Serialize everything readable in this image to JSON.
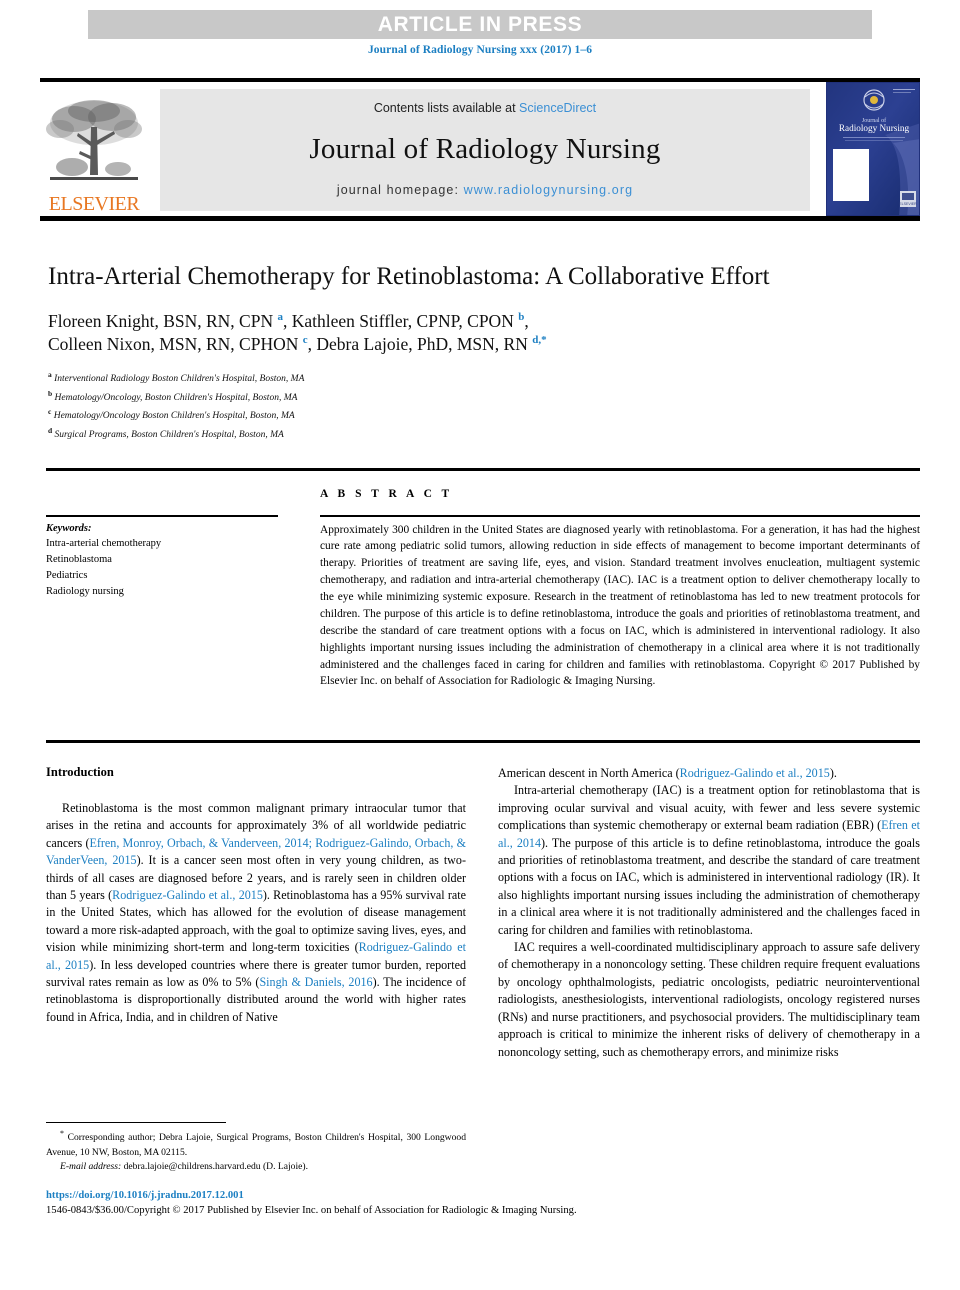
{
  "banner": {
    "article_in_press": "ARTICLE IN PRESS",
    "journal_ref": "Journal of Radiology Nursing xxx (2017) 1–6"
  },
  "masthead": {
    "contents_prefix": "Contents lists available at ",
    "sciencedirect": "ScienceDirect",
    "journal_title": "Journal of Radiology Nursing",
    "homepage_prefix": "journal homepage: ",
    "homepage_url": "www.radiologynursing.org",
    "publisher_logo_text": "ELSEVIER",
    "cover_title_line1": "Journal of",
    "cover_title_line2": "Radiology Nursing"
  },
  "article": {
    "title": "Intra-Arterial Chemotherapy for Retinoblastoma: A Collaborative Effort",
    "authors_line1_a": "Floreen Knight, BSN, RN, CPN ",
    "authors_sup_a": "a",
    "authors_line1_b": ", Kathleen Stiffler, CPNP, CPON ",
    "authors_sup_b": "b",
    "authors_line1_c": ",",
    "authors_line2_a": "Colleen Nixon, MSN, RN, CPHON ",
    "authors_sup_c": "c",
    "authors_line2_b": ", Debra Lajoie, PhD, MSN, RN ",
    "authors_sup_d": "d,*",
    "affiliations": [
      {
        "marker": "a",
        "text": "Interventional Radiology Boston Children's Hospital, Boston, MA"
      },
      {
        "marker": "b",
        "text": "Hematology/Oncology, Boston Children's Hospital, Boston, MA"
      },
      {
        "marker": "c",
        "text": "Hematology/Oncology Boston Children's Hospital, Boston, MA"
      },
      {
        "marker": "d",
        "text": "Surgical Programs, Boston Children's Hospital, Boston, MA"
      }
    ]
  },
  "keywords": {
    "label": "Keywords:",
    "items": [
      "Intra-arterial chemotherapy",
      "Retinoblastoma",
      "Pediatrics",
      "Radiology nursing"
    ]
  },
  "abstract": {
    "label": "A B S T R A C T",
    "text": "Approximately 300 children in the United States are diagnosed yearly with retinoblastoma. For a generation, it has had the highest cure rate among pediatric solid tumors, allowing reduction in side effects of management to become important determinants of therapy. Priorities of treatment are saving life, eyes, and vision. Standard treatment involves enucleation, multiagent systemic chemotherapy, and radiation and intra-arterial chemotherapy (IAC). IAC is a treatment option to deliver chemotherapy locally to the eye while minimizing systemic exposure. Research in the treatment of retinoblastoma has led to new treatment protocols for children. The purpose of this article is to define retinoblastoma, introduce the goals and priorities of retinoblastoma treatment, and describe the standard of care treatment options with a focus on IAC, which is administered in interventional radiology. It also highlights important nursing issues including the administration of chemotherapy in a clinical area where it is not traditionally administered and the challenges faced in caring for children and families with retinoblastoma. Copyright © 2017 Published by Elsevier Inc. on behalf of Association for Radiologic & Imaging Nursing."
  },
  "body": {
    "section_heading": "Introduction",
    "left_col": {
      "p1_part1": "Retinoblastoma is the most common malignant primary intraocular tumor that arises in the retina and accounts for approximately 3% of all worldwide pediatric cancers (",
      "p1_cite1": "Efren, Monroy, Orbach, & Vanderveen, 2014; Rodriguez-Galindo, Orbach, & VanderVeen, 2015",
      "p1_part2": "). It is a cancer seen most often in very young children, as two-thirds of all cases are diagnosed before 2 years, and is rarely seen in children older than 5 years (",
      "p1_cite2": "Rodriguez-Galindo et al., 2015",
      "p1_part3": "). Retinoblastoma has a 95% survival rate in the United States, which has allowed for the evolution of disease management toward a more risk-adapted approach, with the goal to optimize saving lives, eyes, and vision while minimizing short-term and long-term toxicities (",
      "p1_cite3": "Rodriguez-Galindo et al., 2015",
      "p1_part4": "). In less developed countries where there is greater tumor burden, reported survival rates remain as low as 0% to 5% (",
      "p1_cite4": "Singh & Daniels, 2016",
      "p1_part5": "). The incidence of retinoblastoma is disproportionally distributed around the world with higher rates found in Africa, India, and in children of Native"
    },
    "right_col": {
      "p0_part1": "American descent in North America (",
      "p0_cite1": "Rodriguez-Galindo et al., 2015",
      "p0_part2": ").",
      "p1_part1": "Intra-arterial chemotherapy (IAC) is a treatment option for retinoblastoma that is improving ocular survival and visual acuity, with fewer and less severe systemic complications than systemic chemotherapy or external beam radiation (EBR) (",
      "p1_cite1": "Efren et al., 2014",
      "p1_part2": "). The purpose of this article is to define retinoblastoma, introduce the goals and priorities of retinoblastoma treatment, and describe the standard of care treatment options with a focus on IAC, which is administered in interventional radiology (IR). It also highlights important nursing issues including the administration of chemotherapy in a clinical area where it is not traditionally administered and the challenges faced in caring for children and families with retinoblastoma.",
      "p2": "IAC requires a well-coordinated multidisciplinary approach to assure safe delivery of chemotherapy in a nononcology setting. These children require frequent evaluations by oncology ophthalmologists, pediatric oncologists, pediatric neurointerventional radiologists, anesthesiologists, interventional radiologists, oncology registered nurses (RNs) and nurse practitioners, and psychosocial providers. The multidisciplinary team approach is critical to minimize the inherent risks of delivery of chemotherapy in a nononcology setting, such as chemotherapy errors, and minimize risks"
    }
  },
  "footnote": {
    "star": "*",
    "corresponding": " Corresponding author; Debra Lajoie, Surgical Programs, Boston Children's Hospital, 300 Longwood Avenue, 10 NW, Boston, MA 02115.",
    "email_label": "E-mail address:",
    "email": "debra.lajoie@childrens.harvard.edu",
    "email_suffix": " (D. Lajoie)."
  },
  "footer": {
    "doi": "https://doi.org/10.1016/j.jradnu.2017.12.001",
    "copyright": "1546-0843/$36.00/Copyright © 2017 Published by Elsevier Inc. on behalf of Association for Radiologic & Imaging Nursing."
  },
  "colors": {
    "link_blue": "#1c7fc2",
    "sciencedirect_blue": "#3b8fd4",
    "elsevier_orange": "#e87722",
    "banner_gray": "#c8c8c8",
    "masthead_gray": "#e6e6e6",
    "cover_navy": "#1a2f77"
  }
}
